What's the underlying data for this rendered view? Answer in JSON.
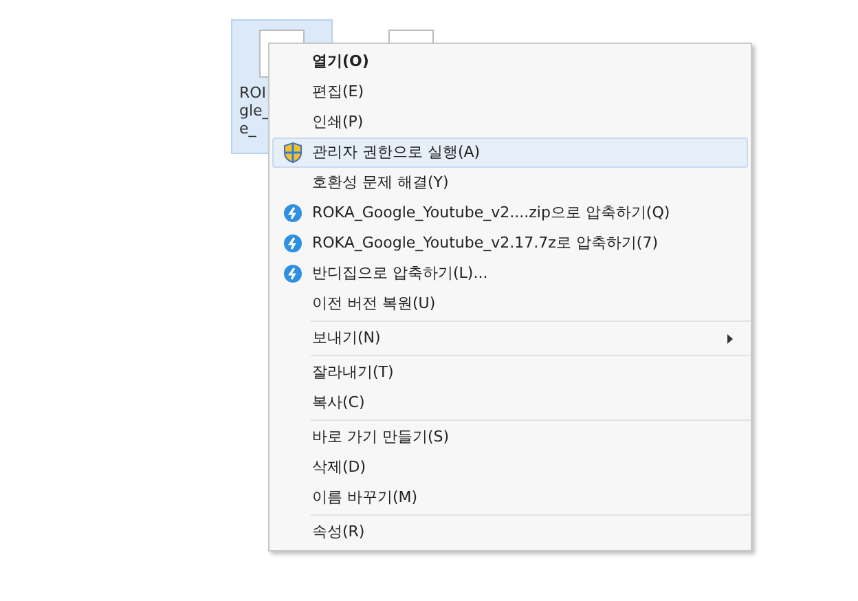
{
  "desktop_icons": [
    {
      "label_lines": [
        "ROI",
        "gle_",
        "e_"
      ],
      "selected": true
    },
    {
      "selected": false
    }
  ],
  "context_menu": {
    "groups": [
      {
        "items": [
          {
            "label": "열기(O)",
            "bold": true,
            "selected": false
          },
          {
            "label": "편집(E)",
            "bold": false,
            "selected": false
          },
          {
            "label": "인쇄(P)",
            "bold": false,
            "selected": false
          },
          {
            "label": "관리자 권한으로 실행(A)",
            "bold": false,
            "selected": true,
            "kind": "shield"
          },
          {
            "label": "호환성 문제 해결(Y)",
            "bold": false,
            "selected": false
          },
          {
            "label": "ROKA_Google_Youtube_v2....zip으로 압축하기(Q)",
            "bold": false,
            "selected": false,
            "kind": "bandizip"
          },
          {
            "label": "ROKA_Google_Youtube_v2.17.7z로 압축하기(7)",
            "bold": false,
            "selected": false,
            "kind": "bandizip"
          },
          {
            "label": "반디집으로 압축하기(L)...",
            "bold": false,
            "selected": false,
            "kind": "bandizip"
          },
          {
            "label": "이전 버전 복원(U)",
            "bold": false,
            "selected": false
          }
        ]
      },
      {
        "items": [
          {
            "label": "보내기(N)",
            "bold": false,
            "selected": false,
            "submenu": true
          }
        ]
      },
      {
        "items": [
          {
            "label": "잘라내기(T)",
            "bold": false,
            "selected": false
          },
          {
            "label": "복사(C)",
            "bold": false,
            "selected": false
          }
        ]
      },
      {
        "items": [
          {
            "label": "바로 가기 만들기(S)",
            "bold": false,
            "selected": false
          },
          {
            "label": "삭제(D)",
            "bold": false,
            "selected": false
          },
          {
            "label": "이름 바꾸기(M)",
            "bold": false,
            "selected": false
          }
        ]
      },
      {
        "items": [
          {
            "label": "속성(R)",
            "bold": false,
            "selected": false
          }
        ]
      }
    ]
  }
}
